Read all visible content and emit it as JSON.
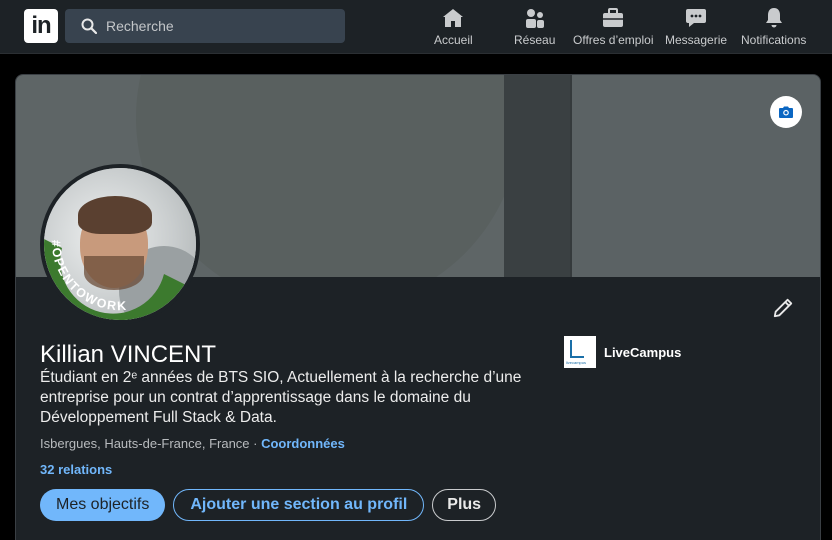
{
  "nav": {
    "logo": "in",
    "search_placeholder": "Recherche",
    "items": [
      {
        "label": "Accueil",
        "icon": "home-icon"
      },
      {
        "label": "Réseau",
        "icon": "network-icon"
      },
      {
        "label": "Offres d’emploi",
        "icon": "briefcase-icon"
      },
      {
        "label": "Messagerie",
        "icon": "messaging-icon"
      },
      {
        "label": "Notifications",
        "icon": "bell-icon"
      }
    ]
  },
  "profile": {
    "badge": "#OPENTOWORK",
    "name": "Killian VINCENT",
    "headline": "Étudiant en 2ᵉ années de BTS SIO, Actuellement à la recherche d’une entreprise pour un contrat d’apprentissage dans le domaine du Développement Full Stack & Data.",
    "location": "Isbergues, Hauts-de-France, France · ",
    "contact_link": "Coordonnées",
    "relations": "32 relations",
    "company": {
      "name": "LiveCampus",
      "logo_text": "livecampus"
    },
    "actions": {
      "primary": "Mes objectifs",
      "secondary": "Ajouter une section au profil",
      "more": "Plus"
    }
  },
  "colors": {
    "accent": "#71b7fb",
    "card_bg": "#1d2226",
    "open_to_work_green": "#3c7a2e"
  }
}
